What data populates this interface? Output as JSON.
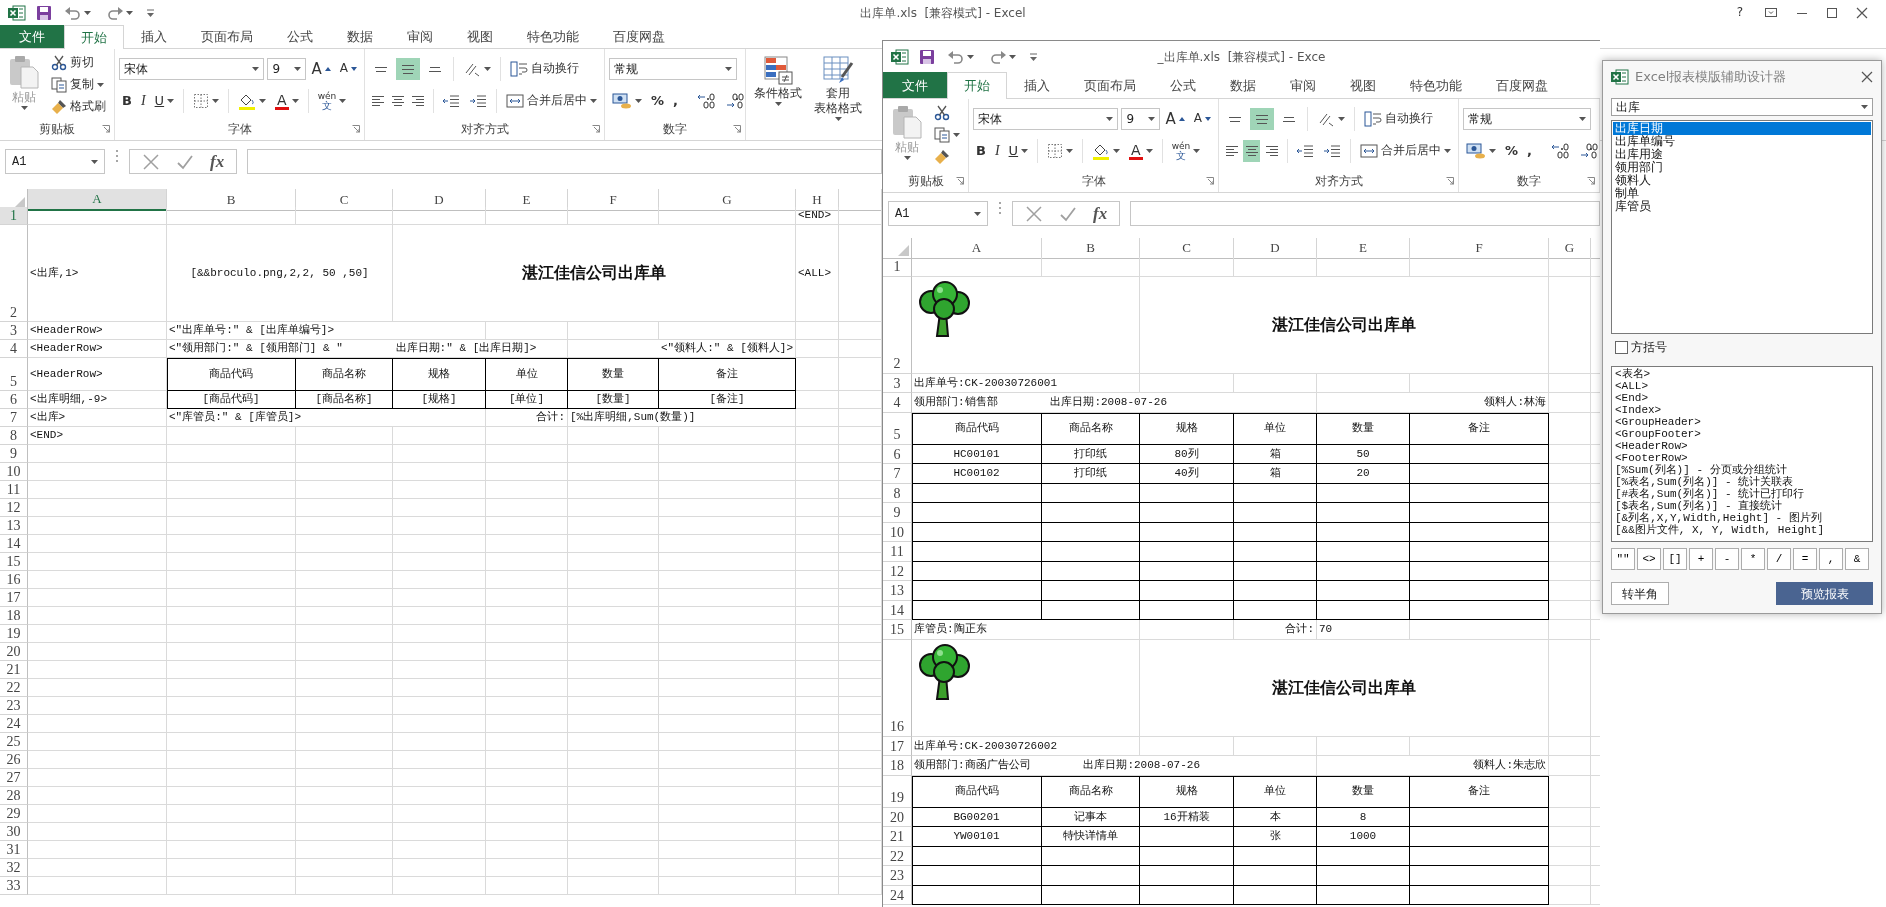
{
  "main_window": {
    "title": "出库单.xls  [兼容模式] - Excel",
    "help": "?",
    "tabs": [
      {
        "label": "文件",
        "kind": "file",
        "selected": false
      },
      {
        "label": "开始",
        "kind": "tab",
        "selected": true
      },
      {
        "label": "插入",
        "kind": "tab",
        "selected": false
      },
      {
        "label": "页面布局",
        "kind": "tab",
        "selected": false
      },
      {
        "label": "公式",
        "kind": "tab",
        "selected": false
      },
      {
        "label": "数据",
        "kind": "tab",
        "selected": false
      },
      {
        "label": "审阅",
        "kind": "tab",
        "selected": false
      },
      {
        "label": "视图",
        "kind": "tab",
        "selected": false
      },
      {
        "label": "特色功能",
        "kind": "tab",
        "selected": false
      },
      {
        "label": "百度网盘",
        "kind": "tab",
        "selected": false
      }
    ],
    "ribbon": [
      {
        "kind": "clipboard",
        "label": "剪贴板",
        "paste": {
          "label": "粘贴",
          "disabled": true
        },
        "items": [
          "剪切",
          "复制",
          "格式刷"
        ]
      },
      {
        "kind": "font",
        "label": "字体",
        "font_name": "宋体",
        "font_size": "9",
        "grow": "A",
        "shrink": "A",
        "bold": "B",
        "italic": "I",
        "underline": "U",
        "font_color": "A",
        "phonetic": "wén",
        "phonetic_char": "文"
      },
      {
        "kind": "alignment",
        "label": "对齐方式",
        "wrap_text": "自动换行",
        "merge": "合并后居中",
        "vertical": [
          {
            "selected": false
          },
          {
            "selected": true
          },
          {
            "selected": false
          }
        ],
        "horizontal": [
          {
            "selected": false
          },
          {
            "selected": false
          },
          {
            "selected": false
          }
        ]
      },
      {
        "kind": "number",
        "label": "数字",
        "format": "常规",
        "percent": "%",
        "comma": ","
      },
      {
        "kind": "styles",
        "buttons": [
          {
            "lines": [
              "条件格式"
            ]
          },
          {
            "lines": [
              "套用",
              "表格格式"
            ]
          }
        ]
      }
    ],
    "formula_bar": {
      "name_box": "A1",
      "function_label": "fx"
    },
    "sheet": {
      "columns": [
        {
          "label": "A",
          "selected": true
        },
        {
          "label": "B",
          "selected": false
        },
        {
          "label": "C",
          "selected": false
        },
        {
          "label": "D",
          "selected": false
        },
        {
          "label": "E",
          "selected": false
        },
        {
          "label": "F",
          "selected": false
        },
        {
          "label": "G",
          "selected": false
        },
        {
          "label": "H",
          "selected": false
        }
      ],
      "rows": [
        {
          "label": "1",
          "selected": true,
          "kind": "normal",
          "cells": [
            {
              "kind": "skip"
            },
            {
              "kind": "skip"
            },
            {
              "kind": "skip"
            },
            {
              "kind": "skip"
            },
            {
              "kind": "skip"
            },
            {
              "kind": "skip"
            },
            {
              "kind": "skip"
            },
            {
              "kind": "text",
              "text": "<END>"
            }
          ]
        },
        {
          "label": "2",
          "selected": false,
          "kind": "title",
          "cells": [
            {
              "kind": "text",
              "text": "<出库,1>"
            },
            {
              "kind": "center",
              "text": "[&&broculo.png,2,2, 50 ,50]"
            },
            {
              "kind": "join"
            },
            {
              "kind": "title",
              "text": "湛江佳信公司出库单"
            },
            {
              "kind": "join"
            },
            {
              "kind": "join"
            },
            {
              "kind": "join"
            },
            {
              "kind": "text",
              "text": "<ALL>"
            }
          ]
        },
        {
          "label": "3",
          "selected": false,
          "kind": "normal",
          "cells": [
            {
              "kind": "text",
              "text": "<HeaderRow>"
            },
            {
              "kind": "text",
              "text": "<\"出库单号:\" & [出库单编号]>"
            },
            {
              "kind": "join"
            },
            {
              "kind": "join"
            }
          ]
        },
        {
          "label": "4",
          "selected": false,
          "kind": "normal",
          "cells": [
            {
              "kind": "text",
              "text": "<HeaderRow>"
            },
            {
              "kind": "text",
              "text": "<\"领用部门:\" & [领用部门] & \"        出库日期:\" & [出库日期]>"
            },
            {
              "kind": "join"
            },
            {
              "kind": "join"
            },
            {
              "kind": "join"
            },
            {
              "kind": "right",
              "text": "<\"领料人:\" & [领料人]>"
            },
            {
              "kind": "join"
            }
          ]
        },
        {
          "label": "5",
          "selected": false,
          "kind": "head",
          "cells": [
            {
              "kind": "text",
              "text": "<HeaderRow>"
            },
            {
              "kind": "boxed",
              "text": "商品代码"
            },
            {
              "kind": "boxed",
              "text": "商品名称"
            },
            {
              "kind": "boxed",
              "text": "规格"
            },
            {
              "kind": "boxed",
              "text": "单位"
            },
            {
              "kind": "boxed",
              "text": "数量"
            },
            {
              "kind": "boxed",
              "text": "备注"
            }
          ]
        },
        {
          "label": "6",
          "selected": false,
          "kind": "normal",
          "cells": [
            {
              "kind": "text",
              "text": "<出库明细,-9>"
            },
            {
              "kind": "boxed",
              "text": "[商品代码]"
            },
            {
              "kind": "boxed",
              "text": "[商品名称]"
            },
            {
              "kind": "boxed",
              "text": "[规格]"
            },
            {
              "kind": "boxed",
              "text": "[单位]"
            },
            {
              "kind": "boxed",
              "text": "[数量]"
            },
            {
              "kind": "boxed",
              "text": "[备注]"
            }
          ]
        },
        {
          "label": "7",
          "selected": false,
          "kind": "normal",
          "cells": [
            {
              "kind": "text",
              "text": "<出库>"
            },
            {
              "kind": "text",
              "text": "<\"库管员:\" & [库管员]>"
            },
            {
              "kind": "join"
            },
            {
              "kind": "join"
            },
            {
              "kind": "right",
              "text": "合计:"
            },
            {
              "kind": "text",
              "text": "[%出库明细,Sum(数量)]"
            },
            {
              "kind": "join"
            }
          ]
        },
        {
          "label": "8",
          "selected": false,
          "kind": "normal",
          "cells": [
            {
              "kind": "text",
              "text": "<END>"
            }
          ]
        },
        {
          "label": "9",
          "selected": false,
          "kind": "normal"
        },
        {
          "label": "10",
          "selected": false,
          "kind": "normal"
        },
        {
          "label": "11",
          "selected": false,
          "kind": "normal"
        },
        {
          "label": "12",
          "selected": false,
          "kind": "normal"
        },
        {
          "label": "13",
          "selected": false,
          "kind": "normal"
        },
        {
          "label": "14",
          "selected": false,
          "kind": "normal"
        },
        {
          "label": "15",
          "selected": false,
          "kind": "normal"
        },
        {
          "label": "16",
          "selected": false,
          "kind": "normal"
        },
        {
          "label": "17",
          "selected": false,
          "kind": "normal"
        },
        {
          "label": "18",
          "selected": false,
          "kind": "normal"
        },
        {
          "label": "19",
          "selected": false,
          "kind": "normal"
        },
        {
          "label": "20",
          "selected": false,
          "kind": "normal"
        },
        {
          "label": "21",
          "selected": false,
          "kind": "normal"
        },
        {
          "label": "22",
          "selected": false,
          "kind": "normal"
        },
        {
          "label": "23",
          "selected": false,
          "kind": "normal"
        },
        {
          "label": "24",
          "selected": false,
          "kind": "normal"
        },
        {
          "label": "25",
          "selected": false,
          "kind": "normal"
        },
        {
          "label": "26",
          "selected": false,
          "kind": "normal"
        },
        {
          "label": "27",
          "selected": false,
          "kind": "normal"
        },
        {
          "label": "28",
          "selected": false,
          "kind": "normal"
        },
        {
          "label": "29",
          "selected": false,
          "kind": "normal"
        },
        {
          "label": "30",
          "selected": false,
          "kind": "normal"
        },
        {
          "label": "31",
          "selected": false,
          "kind": "normal"
        },
        {
          "label": "32",
          "selected": false,
          "kind": "normal"
        },
        {
          "label": "33",
          "selected": false,
          "kind": "normal"
        }
      ]
    }
  },
  "second_window": {
    "title": "_出库单.xls  [兼容模式] - Exce",
    "tabs": [
      {
        "label": "文件",
        "kind": "file",
        "selected": false
      },
      {
        "label": "开始",
        "kind": "tab",
        "selected": true
      },
      {
        "label": "插入",
        "kind": "tab",
        "selected": false
      },
      {
        "label": "页面布局",
        "kind": "tab",
        "selected": false
      },
      {
        "label": "公式",
        "kind": "tab",
        "selected": false
      },
      {
        "label": "数据",
        "kind": "tab",
        "selected": false
      },
      {
        "label": "审阅",
        "kind": "tab",
        "selected": false
      },
      {
        "label": "视图",
        "kind": "tab",
        "selected": false
      },
      {
        "label": "特色功能",
        "kind": "tab",
        "selected": false
      },
      {
        "label": "百度网盘",
        "kind": "tab",
        "selected": false
      }
    ],
    "ribbon": [
      {
        "kind": "clipboard",
        "label": "剪贴板",
        "paste": {
          "label": "粘贴",
          "disabled": true
        }
      },
      {
        "kind": "font",
        "label": "字体",
        "font_name": "宋体",
        "font_size": "9",
        "grow": "A",
        "shrink": "A",
        "bold": "B",
        "italic": "I",
        "underline": "U",
        "font_color": "A",
        "phonetic": "wén",
        "phonetic_char": "文"
      },
      {
        "kind": "alignment",
        "label": "对齐方式",
        "wrap_text": "自动换行",
        "merge": "合并后居中",
        "vertical": [
          {
            "selected": false
          },
          {
            "selected": true
          },
          {
            "selected": false
          }
        ],
        "horizontal": [
          {
            "selected": false
          },
          {
            "selected": true
          },
          {
            "selected": false
          }
        ]
      },
      {
        "kind": "number",
        "label": "数字",
        "format": "常规",
        "percent": "%",
        "comma": ","
      }
    ],
    "formula_bar": {
      "name_box": "A1",
      "function_label": "fx"
    },
    "sheet": {
      "columns": [
        {
          "label": "A",
          "selected": false
        },
        {
          "label": "B",
          "selected": false
        },
        {
          "label": "C",
          "selected": false
        },
        {
          "label": "D",
          "selected": false
        },
        {
          "label": "E",
          "selected": false
        },
        {
          "label": "F",
          "selected": false
        },
        {
          "label": "G",
          "selected": false
        }
      ],
      "rows": [
        {
          "label": "1",
          "selected": false,
          "kind": "normal"
        },
        {
          "label": "2",
          "selected": false,
          "kind": "title",
          "cells": [
            {
              "kind": "picture"
            },
            {
              "kind": "join"
            },
            {
              "kind": "title",
              "text": "湛江佳信公司出库单"
            },
            {
              "kind": "join"
            },
            {
              "kind": "join"
            },
            {
              "kind": "join"
            }
          ]
        },
        {
          "label": "3",
          "selected": false,
          "kind": "normal",
          "cells": [
            {
              "kind": "text",
              "text": "出库单号:CK-20030726001"
            },
            {
              "kind": "join"
            }
          ]
        },
        {
          "label": "4",
          "selected": false,
          "kind": "normal",
          "cells": [
            {
              "kind": "text",
              "text": "领用部门:销售部        出库日期:2008-07-26"
            },
            {
              "kind": "join"
            },
            {
              "kind": "join"
            },
            {
              "kind": "join"
            },
            {
              "kind": "right",
              "text": "领料人:林海"
            },
            {
              "kind": "join"
            }
          ]
        },
        {
          "label": "5",
          "selected": false,
          "kind": "head",
          "cells": [
            {
              "kind": "boxed",
              "text": "商品代码"
            },
            {
              "kind": "boxed",
              "text": "商品名称"
            },
            {
              "kind": "boxed",
              "text": "规格"
            },
            {
              "kind": "boxed",
              "text": "单位"
            },
            {
              "kind": "boxed",
              "text": "数量"
            },
            {
              "kind": "boxed",
              "text": "备注"
            }
          ]
        },
        {
          "label": "6",
          "selected": false,
          "kind": "normal",
          "cells": [
            {
              "kind": "boxed",
              "text": "HC00101"
            },
            {
              "kind": "boxed",
              "text": "打印纸"
            },
            {
              "kind": "boxed",
              "text": "80列"
            },
            {
              "kind": "boxed",
              "text": "箱"
            },
            {
              "kind": "boxed",
              "text": "50"
            },
            {
              "kind": "boxed"
            }
          ]
        },
        {
          "label": "7",
          "selected": false,
          "kind": "normal",
          "cells": [
            {
              "kind": "boxed",
              "text": "HC00102"
            },
            {
              "kind": "boxed",
              "text": "打印纸"
            },
            {
              "kind": "boxed",
              "text": "40列"
            },
            {
              "kind": "boxed",
              "text": "箱"
            },
            {
              "kind": "boxed",
              "text": "20"
            },
            {
              "kind": "boxed"
            }
          ]
        },
        {
          "label": "8",
          "selected": false,
          "kind": "normal",
          "cells": [
            {
              "kind": "boxed"
            },
            {
              "kind": "boxed"
            },
            {
              "kind": "boxed"
            },
            {
              "kind": "boxed"
            },
            {
              "kind": "boxed"
            },
            {
              "kind": "boxed"
            }
          ]
        },
        {
          "label": "9",
          "selected": false,
          "kind": "normal",
          "cells": [
            {
              "kind": "boxed"
            },
            {
              "kind": "boxed"
            },
            {
              "kind": "boxed"
            },
            {
              "kind": "boxed"
            },
            {
              "kind": "boxed"
            },
            {
              "kind": "boxed"
            }
          ]
        },
        {
          "label": "10",
          "selected": false,
          "kind": "normal",
          "cells": [
            {
              "kind": "boxed"
            },
            {
              "kind": "boxed"
            },
            {
              "kind": "boxed"
            },
            {
              "kind": "boxed"
            },
            {
              "kind": "boxed"
            },
            {
              "kind": "boxed"
            }
          ]
        },
        {
          "label": "11",
          "selected": false,
          "kind": "normal",
          "cells": [
            {
              "kind": "boxed"
            },
            {
              "kind": "boxed"
            },
            {
              "kind": "boxed"
            },
            {
              "kind": "boxed"
            },
            {
              "kind": "boxed"
            },
            {
              "kind": "boxed"
            }
          ]
        },
        {
          "label": "12",
          "selected": false,
          "kind": "normal",
          "cells": [
            {
              "kind": "boxed"
            },
            {
              "kind": "boxed"
            },
            {
              "kind": "boxed"
            },
            {
              "kind": "boxed"
            },
            {
              "kind": "boxed"
            },
            {
              "kind": "boxed"
            }
          ]
        },
        {
          "label": "13",
          "selected": false,
          "kind": "normal",
          "cells": [
            {
              "kind": "boxed"
            },
            {
              "kind": "boxed"
            },
            {
              "kind": "boxed"
            },
            {
              "kind": "boxed"
            },
            {
              "kind": "boxed"
            },
            {
              "kind": "boxed"
            }
          ]
        },
        {
          "label": "14",
          "selected": false,
          "kind": "normal",
          "cells": [
            {
              "kind": "boxed"
            },
            {
              "kind": "boxed"
            },
            {
              "kind": "boxed"
            },
            {
              "kind": "boxed"
            },
            {
              "kind": "boxed"
            },
            {
              "kind": "boxed"
            }
          ]
        },
        {
          "label": "15",
          "selected": false,
          "kind": "normal",
          "cells": [
            {
              "kind": "text",
              "text": "库管员:陶正东"
            },
            {
              "kind": "join"
            },
            {
              "kind": "skip"
            },
            {
              "kind": "right",
              "text": "合计:"
            },
            {
              "kind": "text",
              "text": "70"
            }
          ]
        },
        {
          "label": "16",
          "selected": false,
          "kind": "title",
          "cells": [
            {
              "kind": "picture"
            },
            {
              "kind": "join"
            },
            {
              "kind": "title",
              "text": "湛江佳信公司出库单"
            },
            {
              "kind": "join"
            },
            {
              "kind": "join"
            },
            {
              "kind": "join"
            }
          ]
        },
        {
          "label": "17",
          "selected": false,
          "kind": "normal",
          "cells": [
            {
              "kind": "text",
              "text": "出库单号:CK-20030726002"
            },
            {
              "kind": "join"
            }
          ]
        },
        {
          "label": "18",
          "selected": false,
          "kind": "normal",
          "cells": [
            {
              "kind": "text",
              "text": "领用部门:商函广告公司        出库日期:2008-07-26"
            },
            {
              "kind": "join"
            },
            {
              "kind": "join"
            },
            {
              "kind": "join"
            },
            {
              "kind": "right",
              "text": "领料人:朱志欣"
            },
            {
              "kind": "join"
            }
          ]
        },
        {
          "label": "19",
          "selected": false,
          "kind": "head",
          "cells": [
            {
              "kind": "boxed",
              "text": "商品代码"
            },
            {
              "kind": "boxed",
              "text": "商品名称"
            },
            {
              "kind": "boxed",
              "text": "规格"
            },
            {
              "kind": "boxed",
              "text": "单位"
            },
            {
              "kind": "boxed",
              "text": "数量"
            },
            {
              "kind": "boxed",
              "text": "备注"
            }
          ]
        },
        {
          "label": "20",
          "selected": false,
          "kind": "normal",
          "cells": [
            {
              "kind": "boxed",
              "text": "BG00201"
            },
            {
              "kind": "boxed",
              "text": "记事本"
            },
            {
              "kind": "boxed",
              "text": "16开精装"
            },
            {
              "kind": "boxed",
              "text": "本"
            },
            {
              "kind": "boxed",
              "text": "8"
            },
            {
              "kind": "boxed"
            }
          ]
        },
        {
          "label": "21",
          "selected": false,
          "kind": "normal",
          "cells": [
            {
              "kind": "boxed",
              "text": "YW00101"
            },
            {
              "kind": "boxed",
              "text": "特快详情单"
            },
            {
              "kind": "boxed"
            },
            {
              "kind": "boxed",
              "text": "张"
            },
            {
              "kind": "boxed",
              "text": "1000"
            },
            {
              "kind": "boxed"
            }
          ]
        },
        {
          "label": "22",
          "selected": false,
          "kind": "normal",
          "cells": [
            {
              "kind": "boxed"
            },
            {
              "kind": "boxed"
            },
            {
              "kind": "boxed"
            },
            {
              "kind": "boxed"
            },
            {
              "kind": "boxed"
            },
            {
              "kind": "boxed"
            }
          ]
        },
        {
          "label": "23",
          "selected": false,
          "kind": "normal",
          "cells": [
            {
              "kind": "boxed"
            },
            {
              "kind": "boxed"
            },
            {
              "kind": "boxed"
            },
            {
              "kind": "boxed"
            },
            {
              "kind": "boxed"
            },
            {
              "kind": "boxed"
            }
          ]
        },
        {
          "label": "24",
          "selected": false,
          "kind": "normal",
          "cells": [
            {
              "kind": "boxed"
            },
            {
              "kind": "boxed"
            },
            {
              "kind": "boxed"
            },
            {
              "kind": "boxed"
            },
            {
              "kind": "boxed"
            },
            {
              "kind": "boxed"
            }
          ]
        }
      ]
    }
  },
  "designer_dialog": {
    "title": "Excel报表模版辅助设计器",
    "table": "出库",
    "fields": [
      {
        "label": "出库日期",
        "selected": true
      },
      {
        "label": "出库单编号",
        "selected": false
      },
      {
        "label": "出库用途",
        "selected": false
      },
      {
        "label": "领用部门",
        "selected": false
      },
      {
        "label": "领料人",
        "selected": false
      },
      {
        "label": "制单",
        "selected": false
      },
      {
        "label": "库管员",
        "selected": false
      }
    ],
    "brackets": {
      "label": "方括号",
      "checked": false
    },
    "snippets": [
      {
        "text": "<表名>",
        "selected": false
      },
      {
        "text": "<ALL>",
        "selected": false
      },
      {
        "text": "<End>",
        "selected": false
      },
      {
        "text": "<Index>",
        "selected": false
      },
      {
        "text": "<GroupHeader>",
        "selected": false
      },
      {
        "text": "<GroupFooter>",
        "selected": false
      },
      {
        "text": "<HeaderRow>",
        "selected": false
      },
      {
        "text": "<FooterRow>",
        "selected": false
      },
      {
        "text": "[%Sum(列名)] - 分页或分组统计",
        "selected": false
      },
      {
        "text": "[%表名,Sum(列名)] - 统计关联表",
        "selected": false
      },
      {
        "text": "[#表名,Sum(列名)] - 统计已打印行",
        "selected": false
      },
      {
        "text": "[$表名,Sum(列名)] - 直接统计",
        "selected": false
      },
      {
        "text": "[&列名,X,Y,Width,Height] - 图片列",
        "selected": false
      },
      {
        "text": "[&&图片文件, X, Y, Width, Height]",
        "selected": false
      }
    ],
    "symbols": [
      "\"\"",
      "<>",
      "[]",
      "+",
      "-",
      "*",
      "/",
      "=",
      ",",
      "&"
    ],
    "buttons": [
      {
        "label": "转半角",
        "kind": "default"
      },
      {
        "label": "预览报表",
        "kind": "primary"
      }
    ]
  }
}
